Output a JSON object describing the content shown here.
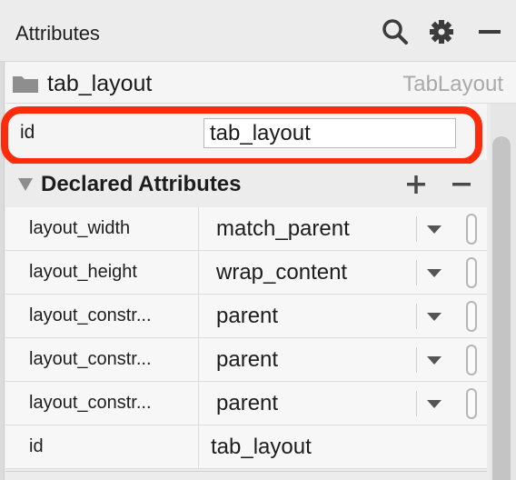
{
  "header": {
    "title": "Attributes",
    "icons": [
      "search-icon",
      "gear-icon",
      "minimize-icon"
    ]
  },
  "component": {
    "icon": "folder-icon",
    "name": "tab_layout",
    "type": "TabLayout"
  },
  "id_field": {
    "label": "id",
    "value": "tab_layout"
  },
  "section": {
    "title": "Declared Attributes",
    "add_icon": "plus-icon",
    "remove_icon": "minus-icon"
  },
  "attributes": [
    {
      "name": "layout_width",
      "value": "match_parent"
    },
    {
      "name": "layout_height",
      "value": "wrap_content"
    },
    {
      "name": "layout_constr...",
      "value": "parent"
    },
    {
      "name": "layout_constr...",
      "value": "parent"
    },
    {
      "name": "layout_constr...",
      "value": "parent"
    },
    {
      "name": "id",
      "value": "tab_layout"
    }
  ],
  "colors": {
    "highlight": "#fb2b0c",
    "panel": "#ececec",
    "row": "#f7f7f7"
  }
}
